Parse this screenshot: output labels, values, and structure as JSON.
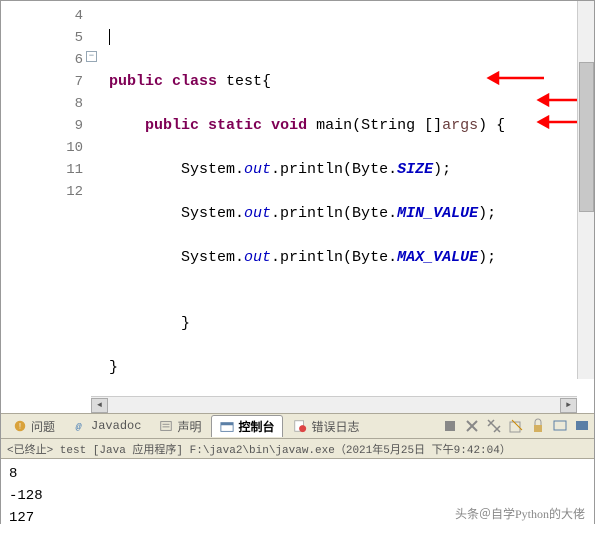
{
  "gutter": [
    "4",
    "5",
    "6",
    "7",
    "8",
    "9",
    "10",
    "11",
    "12"
  ],
  "code": {
    "l4": "",
    "l5_kw1": "public",
    "l5_kw2": "class",
    "l5_name": " test{",
    "l6_kw1": "public",
    "l6_kw2": "static",
    "l6_kw3": "void",
    "l6_rest1": " main(String []",
    "l6_args": "args",
    "l6_rest2": ") {",
    "l7_p1": "System.",
    "l7_out": "out",
    "l7_p2": ".println(Byte.",
    "l7_fld": "SIZE",
    "l7_p3": ");",
    "l8_p1": "System.",
    "l8_out": "out",
    "l8_p2": ".println(Byte.",
    "l8_fld": "MIN_VALUE",
    "l8_p3": ");",
    "l9_p1": "System.",
    "l9_out": "out",
    "l9_p2": ".println(Byte.",
    "l9_fld": "MAX_VALUE",
    "l9_p3": ");",
    "l10": "",
    "l11": "}",
    "l12": "}"
  },
  "tabs": {
    "problems": "问题",
    "javadoc": "Javadoc",
    "decl": "声明",
    "console": "控制台",
    "errlog": "错误日志"
  },
  "console_header": "<已终止> test [Java 应用程序] F:\\java2\\bin\\javaw.exe（2021年5月25日 下午9:42:04）",
  "output": {
    "line1": "8",
    "line2": "-128",
    "line3": "127"
  },
  "watermark": "头条＠自学Python的大佬"
}
